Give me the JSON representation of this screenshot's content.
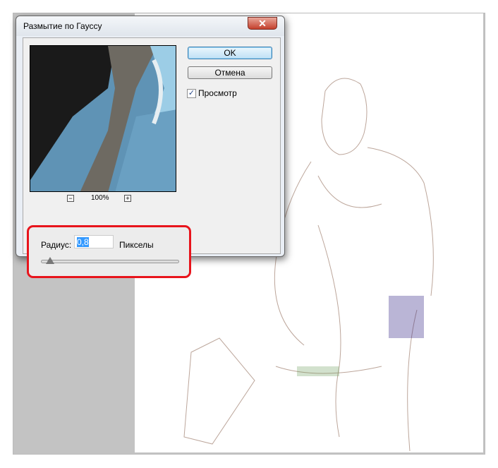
{
  "dialog": {
    "title": "Размытие по Гауссу",
    "close_icon": "close-icon",
    "ok_label": "OK",
    "cancel_label": "Отмена",
    "preview_label": "Просмотр",
    "preview_checked": true,
    "zoom_level": "100%",
    "zoom_out": "−",
    "zoom_in": "+",
    "radius_label": "Радиус:",
    "radius_value": "0,8",
    "radius_units": "Пикселы",
    "slider_fraction": 0.02
  },
  "colors": {
    "highlight": "#e8141c",
    "selection": "#3399ff"
  }
}
